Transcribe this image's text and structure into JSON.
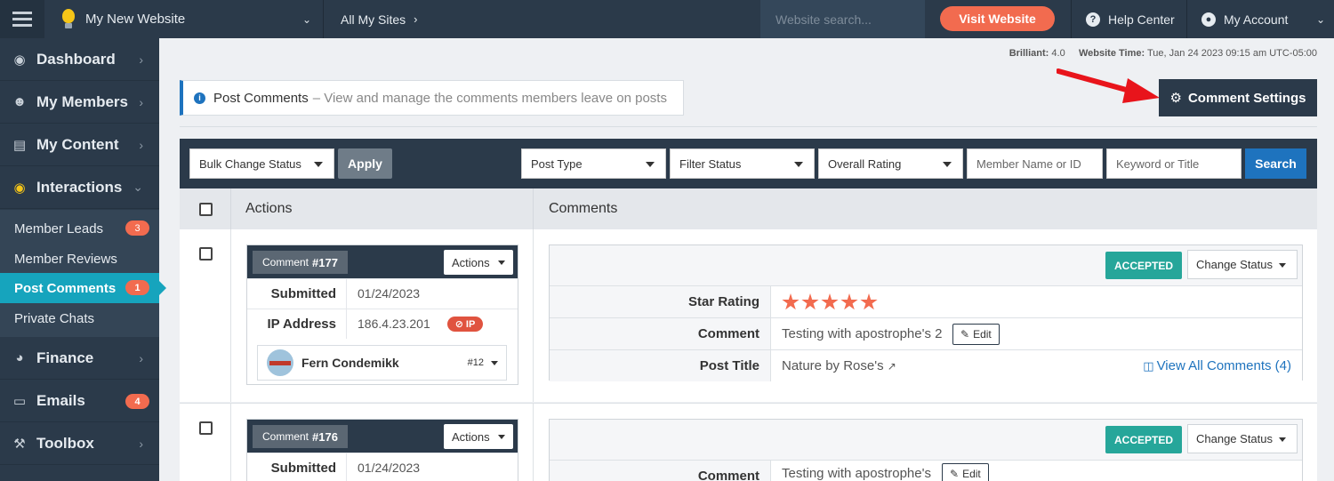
{
  "topbar": {
    "site_name": "My New Website",
    "all_sites": "All My Sites",
    "search_placeholder": "Website search...",
    "visit_website": "Visit Website",
    "help_center": "Help Center",
    "my_account": "My Account"
  },
  "sidebar": {
    "items": [
      {
        "label": "Dashboard",
        "icon": "dashboard-icon"
      },
      {
        "label": "My Members",
        "icon": "users-icon"
      },
      {
        "label": "My Content",
        "icon": "folder-icon"
      },
      {
        "label": "Interactions",
        "icon": "comments-icon"
      },
      {
        "label": "Finance",
        "icon": "pie-chart-icon"
      },
      {
        "label": "Emails",
        "icon": "inbox-icon",
        "badge": "4"
      },
      {
        "label": "Toolbox",
        "icon": "wrench-icon"
      }
    ],
    "subitems": [
      {
        "label": "Member Leads",
        "badge": "3"
      },
      {
        "label": "Member Reviews"
      },
      {
        "label": "Post Comments",
        "badge": "1",
        "active": true
      },
      {
        "label": "Private Chats"
      }
    ]
  },
  "meta": {
    "brilliant_label": "Brilliant:",
    "brilliant_value": "4.0",
    "time_label": "Website Time:",
    "time_value": "Tue, Jan 24 2023 09:15 am UTC-05:00"
  },
  "page": {
    "title": "Post Comments",
    "subtitle": "– View and manage the comments members leave on posts",
    "comment_settings": "Comment Settings"
  },
  "filters": {
    "bulk": "Bulk Change Status",
    "apply": "Apply",
    "post_type": "Post Type",
    "filter_status": "Filter Status",
    "overall_rating": "Overall Rating",
    "member_placeholder": "Member Name or ID",
    "keyword_placeholder": "Keyword or Title",
    "search": "Search"
  },
  "table": {
    "col_actions": "Actions",
    "col_comments": "Comments"
  },
  "comments": [
    {
      "comment_label": "Comment",
      "number": "#177",
      "actions": "Actions",
      "submitted_label": "Submitted",
      "submitted": "01/24/2023",
      "ip_label": "IP Address",
      "ip": "186.4.23.201",
      "ip_badge": "IP",
      "member_name": "Fern Condemikk",
      "member_id": "#12",
      "status": "ACCEPTED",
      "change_status": "Change Status",
      "star_label": "Star Rating",
      "stars": 5,
      "text_label": "Comment",
      "text": "Testing with apostrophe's 2",
      "edit": "Edit",
      "post_title_label": "Post Title",
      "post_title": "Nature by Rose's",
      "view_all": "View All Comments (4)"
    },
    {
      "comment_label": "Comment",
      "number": "#176",
      "actions": "Actions",
      "submitted_label": "Submitted",
      "submitted": "01/24/2023",
      "status": "ACCEPTED",
      "change_status": "Change Status",
      "text_label": "Comment",
      "text": "Testing with apostrophe's",
      "edit": "Edit"
    }
  ],
  "colors": {
    "nav_bg": "#2b3a4a",
    "accent_teal": "#16a4bd",
    "accent_orange": "#f26b4f",
    "accepted_green": "#26a69a",
    "link_blue": "#1e73be"
  }
}
